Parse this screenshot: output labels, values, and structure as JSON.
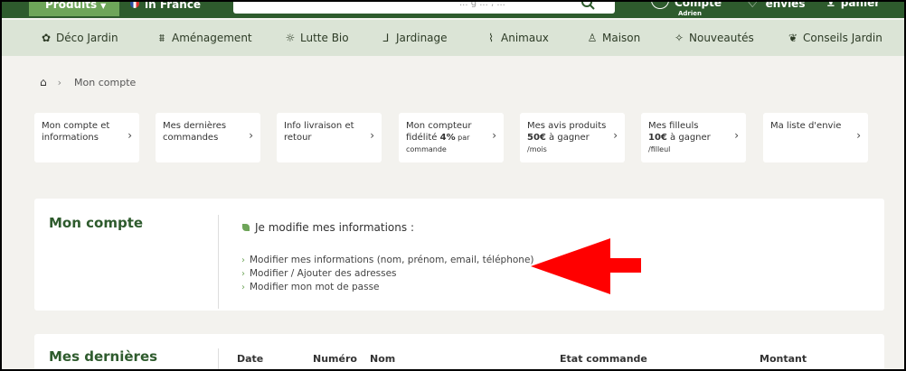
{
  "topbar": {
    "products_label": "Produits",
    "country_label": "in France",
    "search_placeholder": "... g  ...  , ...",
    "account_label": "Compte",
    "account_user": "Adrien",
    "wishlist_label": "envies",
    "cart_label": "panier"
  },
  "nav": {
    "items": [
      {
        "label": "Déco Jardin",
        "icon": "flower-icon"
      },
      {
        "label": "Aménagement",
        "icon": "fence-icon"
      },
      {
        "label": "Lutte Bio",
        "icon": "bug-icon"
      },
      {
        "label": "Jardinage",
        "icon": "tools-icon"
      },
      {
        "label": "Animaux",
        "icon": "feather-icon"
      },
      {
        "label": "Maison",
        "icon": "bottle-icon"
      },
      {
        "label": "Nouveautés",
        "icon": "sparkle-icon"
      },
      {
        "label": "Conseils Jardin",
        "icon": "leaf-book-icon"
      }
    ]
  },
  "breadcrumb": {
    "current": "Mon compte"
  },
  "cards": [
    {
      "line1": "Mon compte et",
      "line2": "informations"
    },
    {
      "line1": "Mes dernières",
      "line2": "commandes"
    },
    {
      "line1": "Info livraison et",
      "line2": "retour"
    },
    {
      "line1": "Mon compteur",
      "line2_pre": "fidélité ",
      "line2_bold": "4%",
      "line2_small": " par",
      "line3_small": "commande"
    },
    {
      "line1": "Mes avis produits",
      "line2_bold": "50€",
      "line2_rest": " à gagner ",
      "line2_small": "/mois"
    },
    {
      "line1": "Mes filleuls",
      "line2_bold": "10€",
      "line2_rest": " à gagner ",
      "line2_small": "/filleul"
    },
    {
      "line1": "Ma liste d'envie"
    }
  ],
  "account_panel": {
    "title": "Mon compte",
    "subtitle": "Je modifie mes informations :",
    "links": [
      "Modifier mes informations (nom, prénom, email, téléphone)",
      "Modifier / Ajouter des adresses",
      "Modifier mon mot de passe"
    ]
  },
  "orders_panel": {
    "title": "Mes dernières",
    "columns": [
      "Date",
      "Numéro",
      "Nom",
      "Etat commande",
      "Montant"
    ]
  },
  "colors": {
    "brand_dark": "#2e5b2d",
    "brand_light": "#6ea559",
    "nav_bg": "#dbe4d6",
    "annotation_arrow": "#ff0000"
  }
}
